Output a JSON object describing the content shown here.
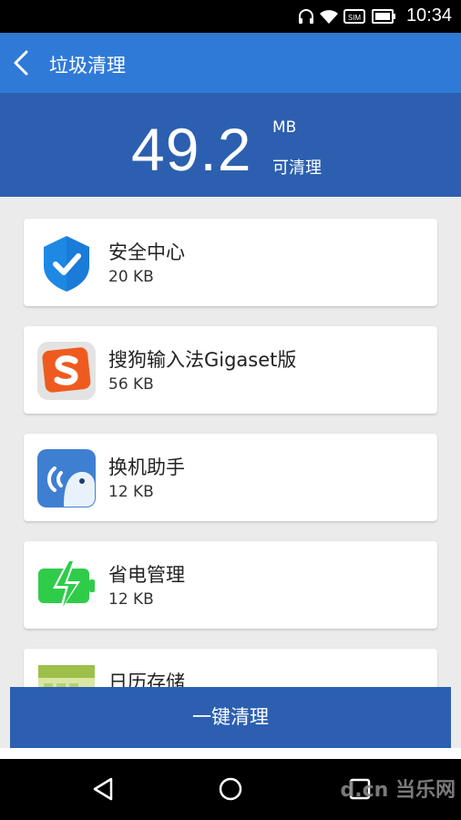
{
  "status": {
    "time": "10:34"
  },
  "header": {
    "title": "垃圾清理"
  },
  "summary": {
    "amount": "49.2",
    "unit": "MB",
    "caption": "可清理"
  },
  "items": [
    {
      "name": "安全中心",
      "size": "20 KB",
      "icon": "shield-check-icon"
    },
    {
      "name": "搜狗输入法Gigaset版",
      "size": "56 KB",
      "icon": "sogou-icon"
    },
    {
      "name": "换机助手",
      "size": "12 KB",
      "icon": "bird-wifi-icon"
    },
    {
      "name": "省电管理",
      "size": "12 KB",
      "icon": "battery-bolt-icon"
    },
    {
      "name": "日历存储",
      "size": "",
      "icon": "calendar-icon"
    }
  ],
  "action": {
    "clean_label": "一键清理"
  },
  "watermark": "d.cn 当乐网",
  "colors": {
    "appbar": "#2f7ad7",
    "summary": "#2c5fb0",
    "button": "#2c5fb0"
  }
}
